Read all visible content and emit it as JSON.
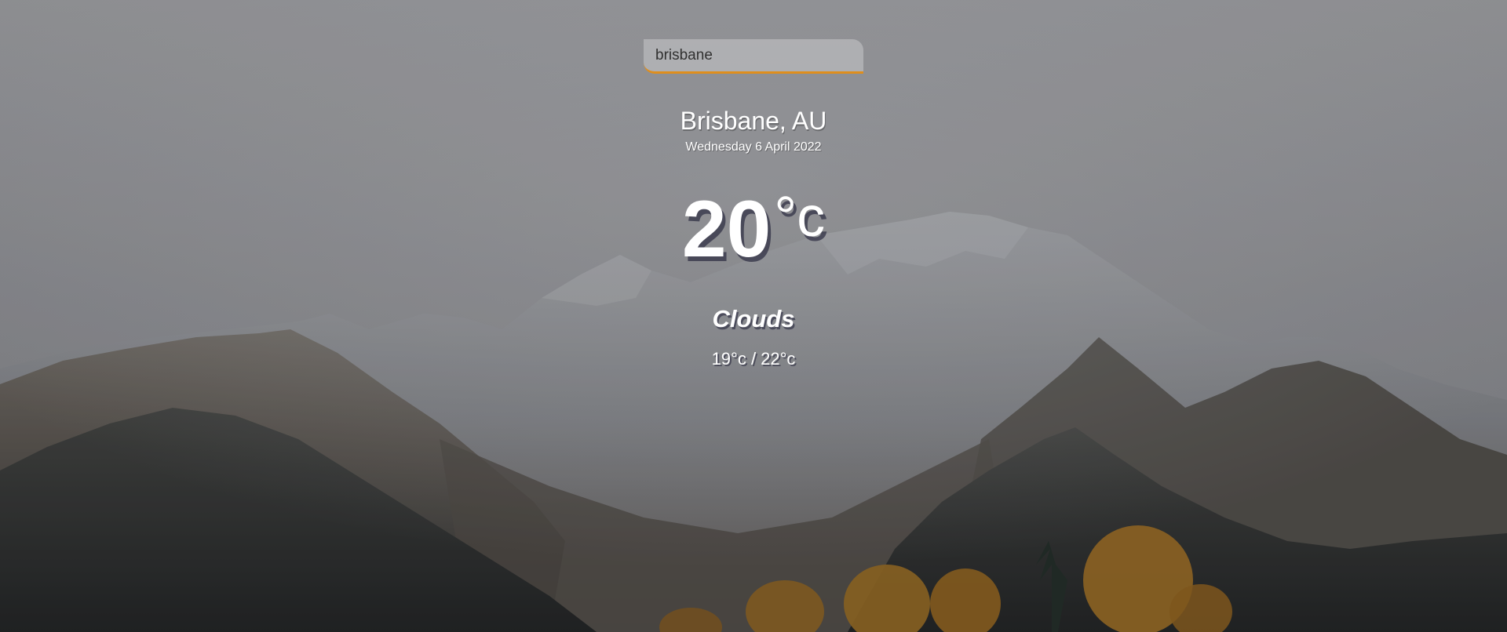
{
  "search": {
    "value": "brisbane"
  },
  "location": {
    "city_country": "Brisbane, AU",
    "date": "Wednesday 6 April 2022"
  },
  "weather": {
    "temperature": "20",
    "unit": "°c",
    "condition": "Clouds",
    "hi_low": "19°c / 22°c"
  },
  "colors": {
    "search_underline": "#df8e1d",
    "text": "#ffffff"
  }
}
